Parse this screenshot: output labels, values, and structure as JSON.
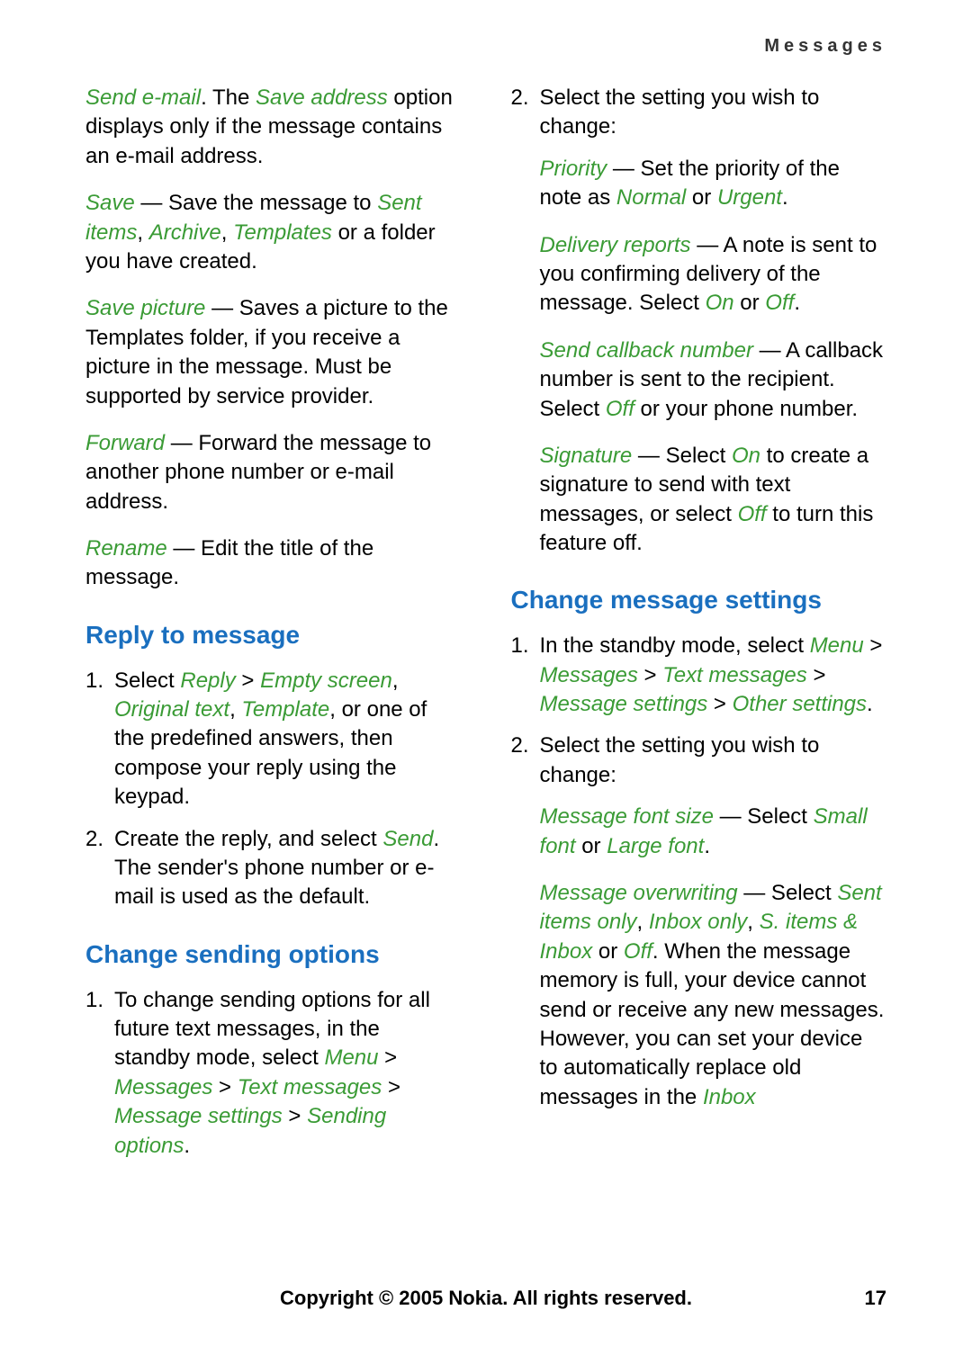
{
  "header": "Messages",
  "left": {
    "p1": {
      "a": "Send e-mail",
      "b": ". The ",
      "c": "Save address",
      "d": " option displays only if the message contains an e-mail address."
    },
    "p2": {
      "a": "Save",
      "b": " — Save the message to ",
      "c": "Sent items",
      "d": ", ",
      "e": "Archive",
      "f": ", ",
      "g": "Templates",
      "h": " or a folder you have created."
    },
    "p3": {
      "a": "Save picture",
      "b": " — Saves a picture to the Templates folder, if you receive a picture in the message. Must be supported by service provider."
    },
    "p4": {
      "a": "Forward",
      "b": " — Forward the message to another phone number or e-mail address."
    },
    "p5": {
      "a": "Rename",
      "b": " — Edit the title of the message."
    },
    "h1": "Reply to message",
    "li1": {
      "a": "Select ",
      "b": "Reply",
      "c": " > ",
      "d": "Empty screen",
      "e": ", ",
      "f": "Original text",
      "g": ", ",
      "h": "Template",
      "i": ", or one of the predefined answers, then compose your reply using the keypad."
    },
    "li2": {
      "a": "Create the reply, and select ",
      "b": "Send",
      "c": ". The sender's phone number or e-mail is used as the default."
    },
    "h2": "Change sending options",
    "li3": {
      "a": "To change sending options for all future text messages, in the standby mode, select ",
      "b": "Menu",
      "c": " > ",
      "d": "Messages",
      "e": " > ",
      "f": "Text messages",
      "g": " > ",
      "h": "Message settings",
      "i": " > ",
      "j": "Sending options",
      "k": "."
    }
  },
  "right": {
    "li1": "Select the setting you wish to change:",
    "ind1": {
      "a": "Priority",
      "b": " — Set the priority of the note as ",
      "c": "Normal",
      "d": " or ",
      "e": "Urgent",
      "f": "."
    },
    "ind2": {
      "a": "Delivery reports",
      "b": " — A note is sent to you confirming delivery of the message. Select ",
      "c": "On",
      "d": " or ",
      "e": "Off",
      "f": "."
    },
    "ind3": {
      "a": "Send callback number",
      "b": " — A callback number is sent to the recipient. Select ",
      "c": "Off",
      "d": " or your phone number."
    },
    "ind4": {
      "a": "Signature",
      "b": " — Select ",
      "c": "On",
      "d": " to create a signature to send with text messages, or select ",
      "e": "Off",
      "f": " to turn this feature off."
    },
    "h1": "Change message settings",
    "li2": {
      "a": "In the standby mode, select ",
      "b": "Menu",
      "c": " > ",
      "d": "Messages",
      "e": " > ",
      "f": "Text messages",
      "g": " > ",
      "h": "Message settings",
      "i": " > ",
      "j": "Other settings",
      "k": "."
    },
    "li3": "Select the setting you wish to change:",
    "ind5": {
      "a": "Message font size",
      "b": " — Select ",
      "c": "Small font",
      "d": " or ",
      "e": "Large font",
      "f": "."
    },
    "ind6": {
      "a": "Message overwriting",
      "b": " — Select ",
      "c": "Sent items only",
      "d": ", ",
      "e": "Inbox only",
      "f": ", ",
      "g": "S. items & Inbox",
      "h": " or ",
      "i": "Off",
      "j": ". When the message memory is full, your device cannot send or receive any new messages. However, you can set your device to automatically replace old messages in the ",
      "k": "Inbox"
    }
  },
  "footer": "Copyright © 2005 Nokia. All rights reserved.",
  "pagenum": "17"
}
